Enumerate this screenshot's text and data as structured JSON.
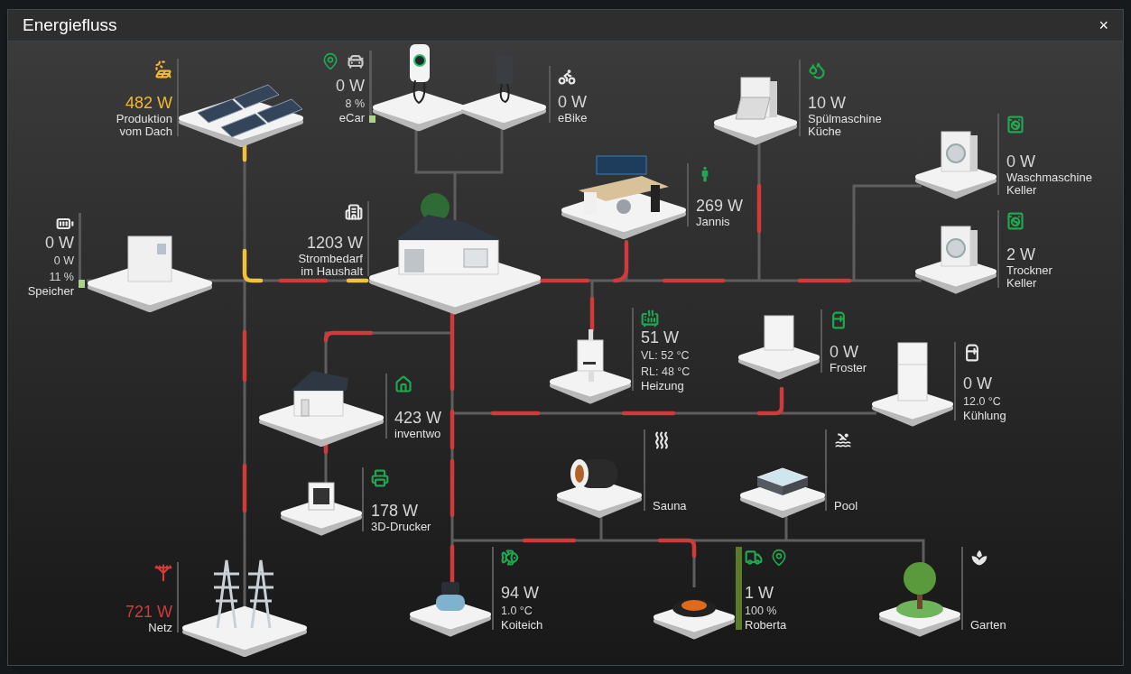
{
  "window": {
    "title": "Energiefluss",
    "close": "×"
  },
  "nodes": [
    {
      "kind": "solar",
      "color": "#f4b731",
      "accent": true,
      "power": "482 W",
      "name": [
        "Produktion",
        "vom Dach"
      ]
    },
    {
      "kind": "wallbox",
      "color": "#c8c8c8",
      "located": true,
      "power": "0 W",
      "readings": [
        "8 %"
      ],
      "name": [
        "eCar"
      ],
      "level": 0.08
    },
    {
      "kind": "ebike",
      "color": "#e6e6e6",
      "power": "0 W",
      "name": [
        "eBike"
      ]
    },
    {
      "kind": "dishwasher",
      "color": "#1fa84f",
      "power": "10 W",
      "name": [
        "Spülmaschine",
        "Küche"
      ]
    },
    {
      "kind": "battery",
      "color": "#e6e6e6",
      "power": "0 W",
      "readings": [
        "0 W",
        "11 %"
      ],
      "name": [
        "Speicher"
      ],
      "level": 0.11
    },
    {
      "kind": "house",
      "color": "#e6e6e6",
      "power": "1203 W",
      "name": [
        "Strombedarf",
        "im Haushalt"
      ]
    },
    {
      "kind": "desk",
      "color": "#1fa84f",
      "power": "269 W",
      "name": [
        "Jannis"
      ]
    },
    {
      "kind": "washer",
      "color": "#1fa84f",
      "power": "0 W",
      "name": [
        "Waschmaschine",
        "Keller"
      ]
    },
    {
      "kind": "dryer",
      "color": "#1fa84f",
      "power": "2 W",
      "name": [
        "Trockner",
        "Keller"
      ]
    },
    {
      "kind": "smallhouse",
      "color": "#1fa84f",
      "power": "423 W",
      "name": [
        "inventwo"
      ]
    },
    {
      "kind": "heater",
      "color": "#1fa84f",
      "power": "51 W",
      "readings": [
        "VL: 52 °C",
        "RL: 48 °C"
      ],
      "name": [
        "Heizung"
      ]
    },
    {
      "kind": "freezer",
      "color": "#1fa84f",
      "power": "0 W",
      "name": [
        "Froster"
      ]
    },
    {
      "kind": "fridge",
      "color": "#e6e6e6",
      "power": "0 W",
      "readings": [
        "12.0 °C"
      ],
      "name": [
        "Kühlung"
      ]
    },
    {
      "kind": "printer",
      "color": "#1fa84f",
      "power": "178 W",
      "name": [
        "3D-Drucker"
      ]
    },
    {
      "kind": "sauna",
      "color": "#e6e6e6",
      "name": [
        "Sauna"
      ]
    },
    {
      "kind": "pool",
      "color": "#e6e6e6",
      "name": [
        "Pool"
      ]
    },
    {
      "kind": "grid",
      "color": "#d13b3b",
      "accent": true,
      "power": "721 W",
      "name": [
        "Netz"
      ]
    },
    {
      "kind": "pump",
      "color": "#1fa84f",
      "power": "94 W",
      "readings": [
        "1.0 °C"
      ],
      "name": [
        "Koiteich"
      ]
    },
    {
      "kind": "mower",
      "color": "#1fa84f",
      "located": true,
      "power": "1 W",
      "readings": [
        "100 %"
      ],
      "name": [
        "Roberta"
      ],
      "level": 1.0
    },
    {
      "kind": "garden",
      "color": "#e6e6e6",
      "name": [
        "Garten"
      ]
    }
  ]
}
